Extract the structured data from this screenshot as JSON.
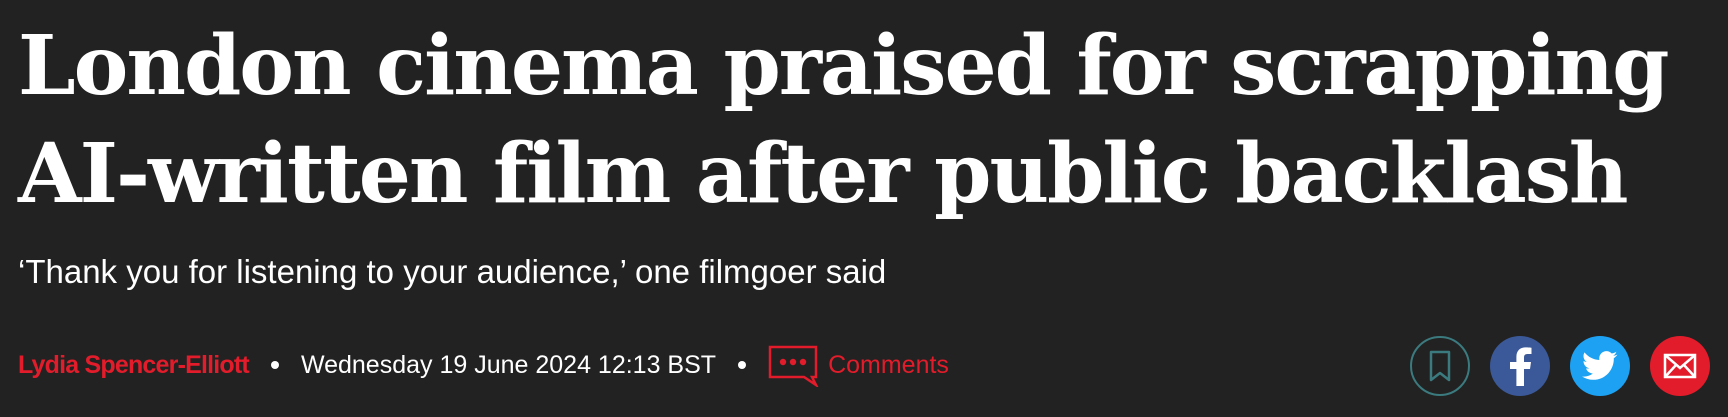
{
  "article": {
    "headline_line1": "London cinema praised for scrapping",
    "headline_line2": "AI-written film after public backlash",
    "standfirst": "‘Thank you for listening to your audience,’ one filmgoer said",
    "author": "Lydia Spencer-Elliott",
    "date": "Wednesday 19 June 2024 12:13 BST",
    "comments_label": "Comments"
  },
  "share": {
    "icons": [
      "bookmark-icon",
      "facebook-icon",
      "twitter-icon",
      "email-icon"
    ]
  },
  "colors": {
    "background": "#222222",
    "text": "#ffffff",
    "accent_red": "#e21c2a",
    "bookmark_ring": "#3b7a7e",
    "facebook": "#3b5998",
    "twitter": "#1da1f2",
    "email": "#e21c2a"
  }
}
